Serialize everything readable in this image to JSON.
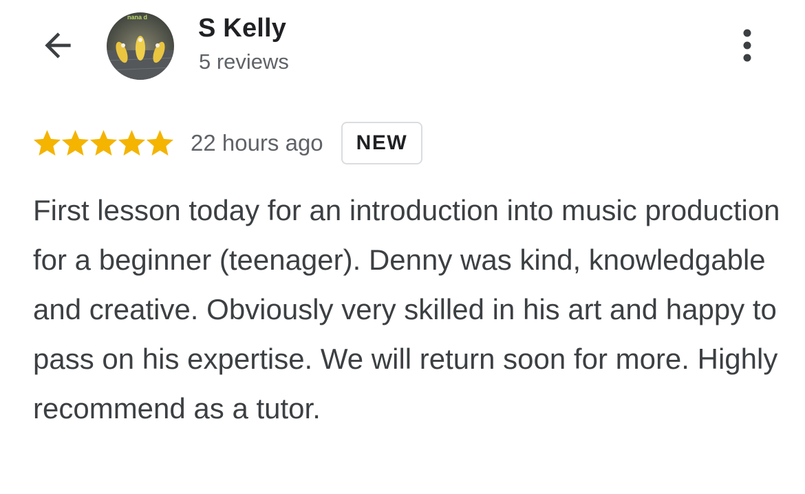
{
  "header": {
    "back_icon": "arrow-back-icon",
    "reviewer_name": "S Kelly",
    "review_count_text": "5 reviews",
    "avatar_text": "nana d",
    "more_icon": "more-vertical-icon"
  },
  "review": {
    "rating": 5,
    "rating_max": 5,
    "star_color": "#f4b400",
    "time_text": "22 hours ago",
    "badge_text": "NEW",
    "body": "First lesson today for an introduction into music production for a beginner (teenager). Denny was kind, knowledgable and creative. Obviously very skilled in his art and happy to pass on his expertise. We will return soon for more. Highly recommend as a tutor."
  }
}
